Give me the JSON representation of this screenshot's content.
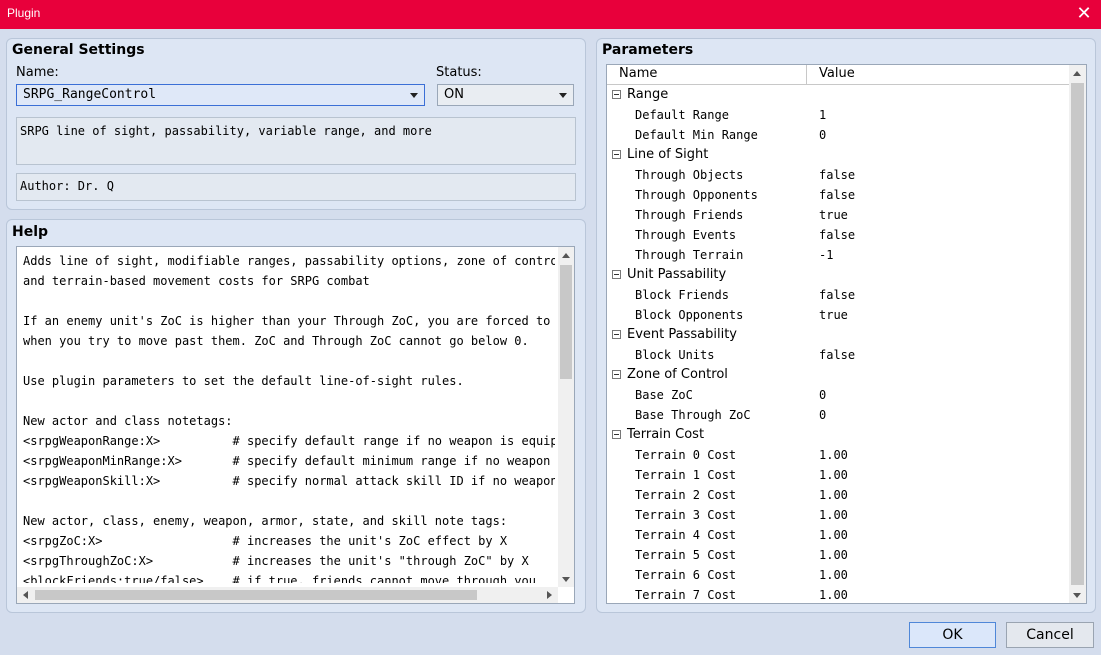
{
  "window": {
    "title": "Plugin",
    "close_glyph": "✕"
  },
  "general": {
    "title": "General Settings",
    "name_label": "Name:",
    "name_value": "SRPG_RangeControl",
    "status_label": "Status:",
    "status_value": "ON",
    "description": "SRPG line of sight, passability, variable range, and more",
    "author": "Author: Dr. Q"
  },
  "help": {
    "title": "Help",
    "lines": [
      "Adds line of sight, modifiable ranges, passability options, zone of control,",
      "and terrain-based movement costs for SRPG combat",
      "",
      "If an enemy unit's ZoC is higher than your Through ZoC, you are forced to stop",
      "when you try to move past them. ZoC and Through ZoC cannot go below 0.",
      "",
      "Use plugin parameters to set the default line-of-sight rules.",
      "",
      "New actor and class notetags:",
      "<srpgWeaponRange:X>          # specify default range if no weapon is equipped",
      "<srpgWeaponMinRange:X>       # specify default minimum range if no weapon is equipped",
      "<srpgWeaponSkill:X>          # specify normal attack skill ID if no weapon is equipped",
      "",
      "New actor, class, enemy, weapon, armor, state, and skill note tags:",
      "<srpgZoC:X>                  # increases the unit's ZoC effect by X",
      "<srpgThroughZoC:X>           # increases the unit's \"through ZoC\" by X",
      "<blockFriends:true/false>    # if true, friends cannot move through you"
    ]
  },
  "parameters": {
    "title": "Parameters",
    "col_name": "Name",
    "col_value": "Value",
    "rows": [
      {
        "name": "Range",
        "value": "",
        "group": true
      },
      {
        "name": "Default Range",
        "value": "1",
        "group": false
      },
      {
        "name": "Default Min Range",
        "value": "0",
        "group": false
      },
      {
        "name": "Line of Sight",
        "value": "",
        "group": true
      },
      {
        "name": "Through Objects",
        "value": "false",
        "group": false
      },
      {
        "name": "Through Opponents",
        "value": "false",
        "group": false
      },
      {
        "name": "Through Friends",
        "value": "true",
        "group": false
      },
      {
        "name": "Through Events",
        "value": "false",
        "group": false
      },
      {
        "name": "Through Terrain",
        "value": "-1",
        "group": false
      },
      {
        "name": "Unit Passability",
        "value": "",
        "group": true
      },
      {
        "name": "Block Friends",
        "value": "false",
        "group": false
      },
      {
        "name": "Block Opponents",
        "value": "true",
        "group": false
      },
      {
        "name": "Event Passability",
        "value": "",
        "group": true
      },
      {
        "name": "Block Units",
        "value": "false",
        "group": false
      },
      {
        "name": "Zone of Control",
        "value": "",
        "group": true
      },
      {
        "name": "Base ZoC",
        "value": "0",
        "group": false
      },
      {
        "name": "Base Through ZoC",
        "value": "0",
        "group": false
      },
      {
        "name": "Terrain Cost",
        "value": "",
        "group": true
      },
      {
        "name": "Terrain 0 Cost",
        "value": "1.00",
        "group": false
      },
      {
        "name": "Terrain 1 Cost",
        "value": "1.00",
        "group": false
      },
      {
        "name": "Terrain 2 Cost",
        "value": "1.00",
        "group": false
      },
      {
        "name": "Terrain 3 Cost",
        "value": "1.00",
        "group": false
      },
      {
        "name": "Terrain 4 Cost",
        "value": "1.00",
        "group": false
      },
      {
        "name": "Terrain 5 Cost",
        "value": "1.00",
        "group": false
      },
      {
        "name": "Terrain 6 Cost",
        "value": "1.00",
        "group": false
      },
      {
        "name": "Terrain 7 Cost",
        "value": "1.00",
        "group": false
      }
    ]
  },
  "buttons": {
    "ok": "OK",
    "cancel": "Cancel"
  }
}
